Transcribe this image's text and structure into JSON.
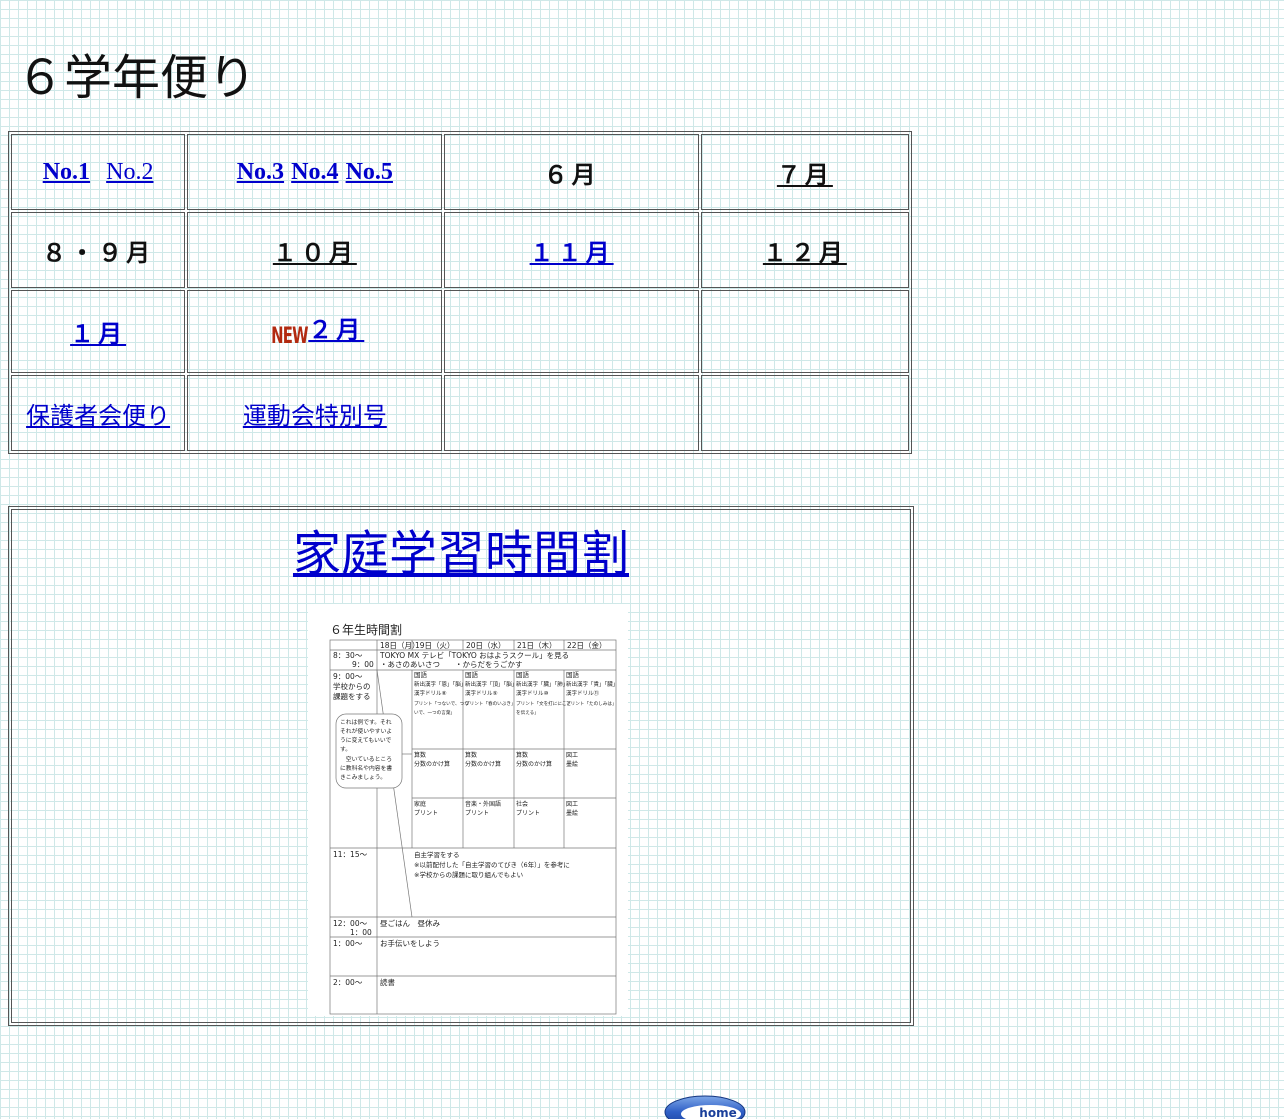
{
  "page": {
    "title": "６学年便り"
  },
  "links": {
    "no1": "No.1",
    "no2": "No.2",
    "no3": "No.3",
    "no4": "No.4",
    "no5": "No.5",
    "june": "６月",
    "july": "７月",
    "aug_sep": "８・９月",
    "oct": "１０月",
    "nov": "１１月",
    "dec": "１２月",
    "jan": "１月",
    "new_badge": "NEW",
    "feb": "２月",
    "parents_letter": "保護者会便り",
    "sports_day_special": "運動会特別号"
  },
  "schedule": {
    "heading": "家庭学習時間割",
    "image": {
      "title": "６年生時間割",
      "days": [
        "18日（月）",
        "19日（火）",
        "20日（水）",
        "21日（木）",
        "22日（金）"
      ],
      "row_0830_time": "8：30〜",
      "row_0830_time2": "9：00",
      "row_0830_text1": "TOKYO MX テレビ「TOKYO おはようスクール」を見る",
      "row_0830_text2": "・あさのあいさつ　　・からだをうごかす",
      "row_0900_time": "9：00〜",
      "row_0900_label1": "学校からの",
      "row_0900_label2": "課題をする",
      "bubble_lines": [
        "これは例です。それ",
        "それが使いやすいよ",
        "うに変えてもいいで",
        "す。",
        "　空いているところ",
        "に教科名や内容を書",
        "きこみましょう。"
      ],
      "p1": [
        [
          "国語",
          "新出漢字「恩」「脳」",
          "漢字ドリル⑧",
          "プリント「つないで、つな",
          "いで、一つの言葉」"
        ],
        [
          "国語",
          "新出漢字「頂」「脳」",
          "漢字ドリル⑨",
          "プリント「春のいぶき」"
        ],
        [
          "国語",
          "新出漢字「臓」「肺」",
          "漢字ドリル⑩",
          "プリント「文を打ににこと",
          "を伝える」"
        ],
        [
          "国語",
          "新出漢字「貴」「臓」",
          "漢字ドリル⑪",
          "プリント「たのしみは」"
        ]
      ],
      "p2": [
        [
          "算数",
          "分数のかけ算"
        ],
        [
          "算数",
          "分数のかけ算"
        ],
        [
          "算数",
          "分数のかけ算"
        ],
        [
          "図工",
          "墨絵"
        ]
      ],
      "p3": [
        [
          "家庭",
          "プリント"
        ],
        [
          "音楽・外国語",
          "プリント"
        ],
        [
          "社会",
          "プリント"
        ],
        [
          "図工",
          "墨絵"
        ]
      ],
      "row_1115_time": "11：15〜",
      "row_1115_lines": [
        "自主学習をする",
        "※以前配付した「自主学習のてびき（6年）」を参考に",
        "※学校からの課題に取り組んでもよい"
      ],
      "row_1200_time": "12：00〜",
      "row_1200_time2": "1：00",
      "row_1200_text": "昼ごはん　昼休み",
      "row_100_time": "1：00〜",
      "row_100_text": "お手伝いをしよう",
      "row_200_time": "2：00〜",
      "row_200_text": "読書"
    }
  },
  "footer": {
    "home_label": "home"
  },
  "colors": {
    "link": "#0000cc",
    "new_badge": "#b22a10",
    "grid": "#cfe8e8"
  }
}
